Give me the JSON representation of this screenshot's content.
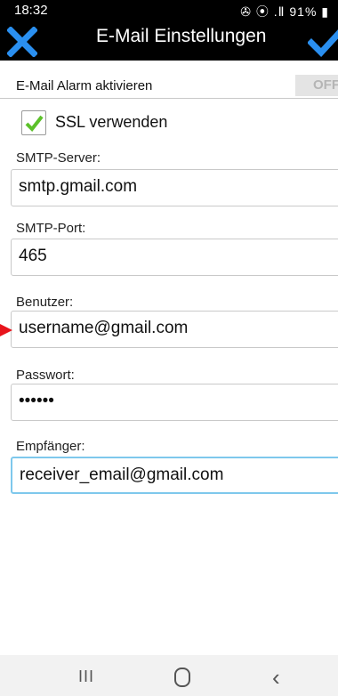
{
  "status": {
    "time": "18:32",
    "icons_text": "✇ ⦿ .Ⅱ 91% ▮"
  },
  "appbar": {
    "title": "E-Mail Einstellungen"
  },
  "alarm": {
    "label": "E-Mail Alarm aktivieren",
    "toggle": "OFF"
  },
  "ssl": {
    "label": "SSL verwenden",
    "checked": true
  },
  "fields": [
    {
      "label": "SMTP-Server:",
      "value": "smtp.gmail.com"
    },
    {
      "label": "SMTP-Port:",
      "value": "465"
    },
    {
      "label": "Benutzer:",
      "value": "username@gmail.com"
    },
    {
      "label": "Passwort:",
      "value": "••••••"
    },
    {
      "label": "Empfänger:",
      "value": "receiver_email@gmail.com"
    }
  ],
  "nav": {
    "recent": "III",
    "back": "‹"
  },
  "colors": {
    "accent": "#2196f3",
    "check": "#5cc12a",
    "arrow": "#e8141c",
    "focus": "#7ec8ec"
  },
  "icons": [
    "close-icon",
    "checkmark-icon",
    "checkbox-checked-icon",
    "arrow-indicator",
    "home-icon"
  ]
}
